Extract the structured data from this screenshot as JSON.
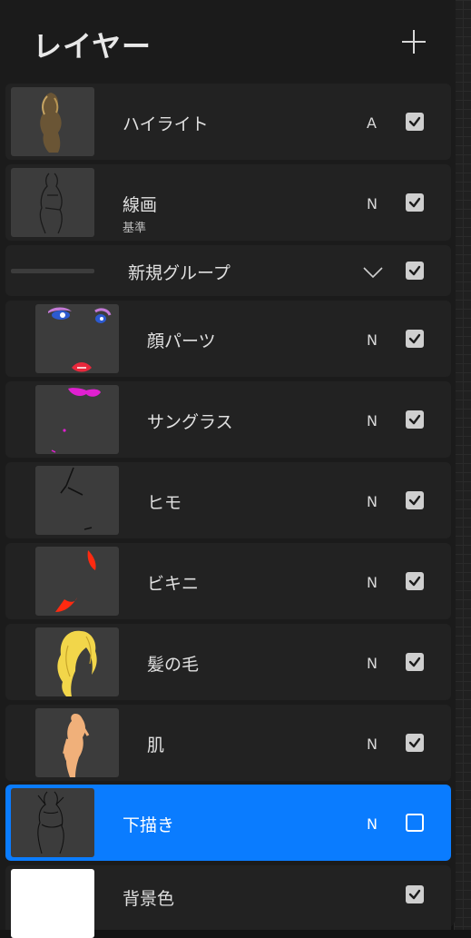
{
  "panel": {
    "title": "レイヤー",
    "add_icon": "plus-icon"
  },
  "layers": [
    {
      "name": "ハイライト",
      "blend": "A",
      "visible": true
    },
    {
      "name": "線画",
      "sub": "基準",
      "blend": "N",
      "visible": true
    },
    {
      "name": "新規グループ",
      "group": true,
      "expanded": true,
      "visible": true
    },
    {
      "name": "顔パーツ",
      "blend": "N",
      "visible": true
    },
    {
      "name": "サングラス",
      "blend": "N",
      "visible": true
    },
    {
      "name": "ヒモ",
      "blend": "N",
      "visible": true
    },
    {
      "name": "ビキニ",
      "blend": "N",
      "visible": true
    },
    {
      "name": "髪の毛",
      "blend": "N",
      "visible": true
    },
    {
      "name": "肌",
      "blend": "N",
      "visible": true
    },
    {
      "name": "下描き",
      "blend": "N",
      "visible": false,
      "selected": true
    },
    {
      "name": "背景色",
      "visible": true
    }
  ],
  "colors": {
    "selected": "#0a7cff",
    "panel": "#1b1b1b",
    "row": "#222222"
  }
}
